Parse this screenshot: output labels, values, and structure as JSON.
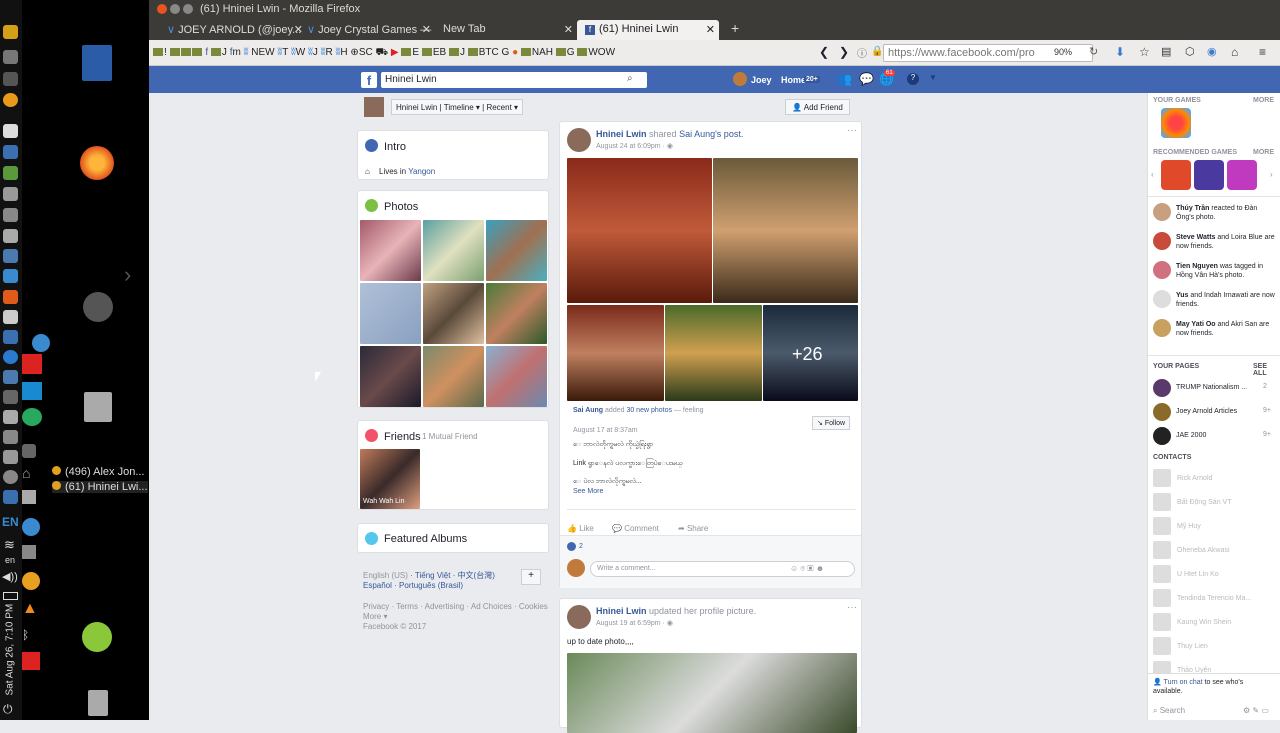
{
  "desktop": {
    "clock": "Sat Aug 26, 7:10 PM",
    "lang": "EN",
    "lang2": "en",
    "taskbar_items": [
      "(496) Alex Jon...",
      "(61) Hninei Lwi..."
    ]
  },
  "browser": {
    "window_title": "(61) Hninei Lwin - Mozilla Firefox",
    "tabs": [
      {
        "label": "JOEY ARNOLD (@joey..."
      },
      {
        "label": "Joey Crystal Games —"
      },
      {
        "label": "New Tab"
      },
      {
        "label": "(61) Hninei Lwin"
      }
    ],
    "bookmarks": [
      "!",
      "J",
      "m",
      "NEW",
      "T",
      "W",
      "J",
      "R",
      "H",
      "SC",
      "E",
      "EB",
      "J",
      "BTC",
      "G",
      "NAH",
      "G",
      "WOW"
    ],
    "url": "https://www.facebook.com/pro",
    "zoom": "90%"
  },
  "fb": {
    "search_value": "Hninei Lwin",
    "user": "Joey",
    "home": "Home",
    "home_count": "20+",
    "notif_count": "61",
    "profile_nav": {
      "name": "Hninei Lwin",
      "timeline": "Timeline",
      "recent": "Recent",
      "add_friend": "Add Friend"
    },
    "intro": {
      "title": "Intro",
      "lives_in": "Lives in",
      "city": "Yangon"
    },
    "photos_title": "Photos",
    "friends": {
      "title": "Friends",
      "mutual": "1 Mutual Friend",
      "friend_name": "Wah Wah Lin"
    },
    "featured_albums": "Featured Albums",
    "languages": {
      "line1_a": "English (US)",
      "line1_b": "Tiếng Việt",
      "line1_c": "中文(台灣)",
      "line2_a": "Español",
      "line2_b": "Português (Brasil)"
    },
    "footer": {
      "line1": "Privacy · Terms · Advertising · Ad Choices · Cookies",
      "line2": "More ▾",
      "line3": "Facebook © 2017"
    },
    "post1": {
      "author": "Hninei Lwin",
      "action": "shared",
      "target": "Sai Aung's post.",
      "date": "August 24 at 6:09pm",
      "more_count": "+26",
      "shared_author": "Sai Aung",
      "shared_action": "added",
      "shared_count": "30 new photos",
      "shared_feeling": "— feeling",
      "shared_date": "August 17 at 8:37am",
      "follow": "Follow",
      "text1": "ေ ဘာလဲတိုက္ရမလဲ ကိုယ္ပဲရြးရွာ",
      "text2": "Link ရွာေနလဲ ပလက္ဖားေတြပဲေပးမယ္",
      "text3": "ေ ပဲလ ဘာလဲလိုက္ရမလဲ...",
      "see_more": "See More",
      "like": "Like",
      "comment": "Comment",
      "share": "Share",
      "reactions": "2",
      "write_comment": "Write a comment..."
    },
    "post2": {
      "author": "Hninei Lwin",
      "action": "updated her profile picture.",
      "date": "August 19 at 6:59pm",
      "text": "up to date photo,,,,"
    },
    "right": {
      "your_games": "YOUR GAMES",
      "more": "MORE",
      "recommended_games": "RECOMMENDED GAMES",
      "more2": "MORE",
      "ticker": [
        {
          "name": "Thúy Trần",
          "text": "reacted to Đàn Ông's photo."
        },
        {
          "name": "Steve Watts",
          "text": "and Loira Blue are now friends."
        },
        {
          "name": "Tien Nguyen",
          "text": "was tagged in Hồng Vân Hà's photo."
        },
        {
          "name": "Yus",
          "text": "and Indah Irnawati are now friends."
        },
        {
          "name": "May Yati Oo",
          "text": "and Akri San are now friends."
        }
      ],
      "your_pages": "YOUR PAGES",
      "see_all": "SEE ALL",
      "pages": [
        {
          "name": "TRUMP Nationalism ...",
          "count": "2"
        },
        {
          "name": "Joey Arnold Articles",
          "count": "9+"
        },
        {
          "name": "JAE 2000",
          "count": "9+"
        }
      ],
      "contacts_title": "CONTACTS",
      "contacts": [
        "Rick Arnold",
        "Bất Động Sản VT",
        "Mỹ Huy",
        "Oheneba Akwasi",
        "U Htet Lin Ko",
        "Tendinda Terencio Ma...",
        "Kaung Win Shein",
        "Thuy Lien",
        "Thảo Uyên"
      ],
      "chat_line": "Turn on chat",
      "chat_rest": "to see who's available.",
      "search_placeholder": "Search"
    }
  }
}
